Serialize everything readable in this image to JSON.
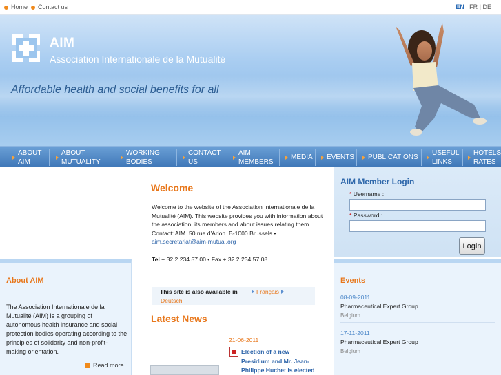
{
  "topbar": {
    "links": [
      "Home",
      "Contact us"
    ],
    "languages": [
      "EN",
      "FR",
      "DE"
    ],
    "active_language": "EN",
    "separator": "|"
  },
  "banner": {
    "logo_title": "AIM",
    "logo_subtitle": "Association Internationale de la Mutualité",
    "tagline": "Affordable health and social benefits for all"
  },
  "nav": {
    "items": [
      {
        "line1": "ABOUT",
        "line2": "AIM"
      },
      {
        "line1": "ABOUT",
        "line2": "MUTUALITY"
      },
      {
        "line1": "WORKING",
        "line2": "BODIES"
      },
      {
        "line1": "CONTACT",
        "line2": "US"
      },
      {
        "line1": "AIM",
        "line2": "MEMBERS"
      },
      {
        "line1": "MEDIA",
        "line2": ""
      },
      {
        "line1": "EVENTS",
        "line2": ""
      },
      {
        "line1": "PUBLICATIONS",
        "line2": ""
      },
      {
        "line1": "USEFUL",
        "line2": "LINKS"
      },
      {
        "line1": "HOTELS",
        "line2": "RATES"
      }
    ]
  },
  "about": {
    "heading": "About AIM",
    "text": "The Association Internationale de la Mutualité (AIM) is a grouping of autonomous health insurance and social protection bodies operating according to the principles of solidarity and non-profit-making orientation.",
    "read_more": "Read more"
  },
  "welcome": {
    "heading": "Welcome",
    "text": "Welcome to the website of the Association Internationale de la Mutualité (AIM). This website provides you with information about the association, its members and about issues relating them. Contact: AIM. 50 rue d'Arlon. B-1000 Brussels •",
    "email": "aim.secretariat@aim-mutual.org",
    "tel_label": "Tel",
    "tel": "+ 32 2 234 57 00 • Fax + 32 2 234 57 08"
  },
  "availability": {
    "label": "This site is also available in",
    "languages": [
      "Français",
      "Deutsch"
    ]
  },
  "news": {
    "heading": "Latest News",
    "items": [
      {
        "date": "21-06-2011",
        "title": "Election of a new Presidium and Mr. Jean-Philippe Huchet is elected"
      }
    ]
  },
  "login": {
    "heading": "AIM Member Login",
    "username_label": "Username :",
    "password_label": "Password :",
    "required_mark": "*",
    "button": "Login"
  },
  "events": {
    "heading": "Events",
    "items": [
      {
        "date": "08-09-2011",
        "title": "Pharmaceutical Expert Group",
        "place": "Belgium"
      },
      {
        "date": "17-11-2011",
        "title": "Pharmaceutical Expert Group",
        "place": "Belgium"
      }
    ]
  },
  "colors": {
    "accent_orange": "#e8771b",
    "nav_blue": "#3f77b8",
    "link_blue": "#2a62a8"
  }
}
